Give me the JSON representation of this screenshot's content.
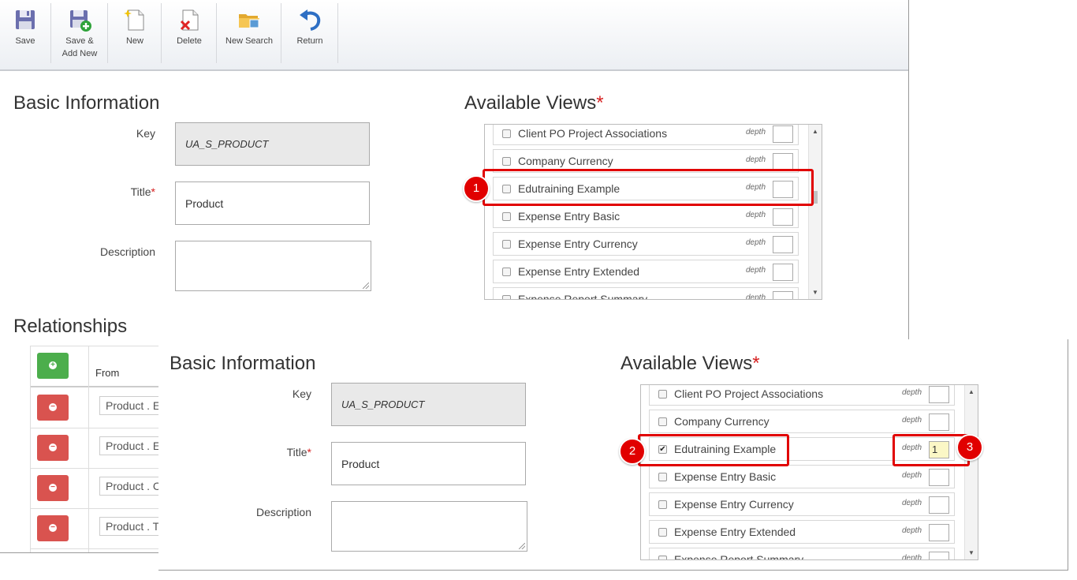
{
  "toolbar": {
    "save": "Save",
    "save_add_new_line1": "Save &",
    "save_add_new_line2": "Add New",
    "new": "New",
    "delete": "Delete",
    "new_search": "New Search",
    "return": "Return"
  },
  "basic_info": {
    "title": "Basic Information",
    "key_label": "Key",
    "key_value": "UA_S_PRODUCT",
    "title_label": "Title",
    "title_value": "Product",
    "description_label": "Description",
    "description_value": ""
  },
  "available_views": {
    "title": "Available Views",
    "depth_label": "depth",
    "items": [
      {
        "name": "Client PO Project Associations"
      },
      {
        "name": "Company Currency"
      },
      {
        "name": "Edutraining Example"
      },
      {
        "name": "Expense Entry Basic"
      },
      {
        "name": "Expense Entry Currency"
      },
      {
        "name": "Expense Entry Extended"
      },
      {
        "name": "Expense Report Summary"
      }
    ],
    "selected_item": "Edutraining Example",
    "selected_depth": "1"
  },
  "relationships": {
    "title": "Relationships",
    "from_header": "From",
    "rows": [
      "Product . E",
      "Product . E",
      "Product . C",
      "Product . T"
    ]
  },
  "annotations": {
    "badge_1": "1",
    "badge_2": "2",
    "badge_3": "3"
  },
  "colors": {
    "required_star": "#d61f1f",
    "annotation_red": "#e10000",
    "add_green": "#4cae4c",
    "delete_red": "#d9534f"
  }
}
